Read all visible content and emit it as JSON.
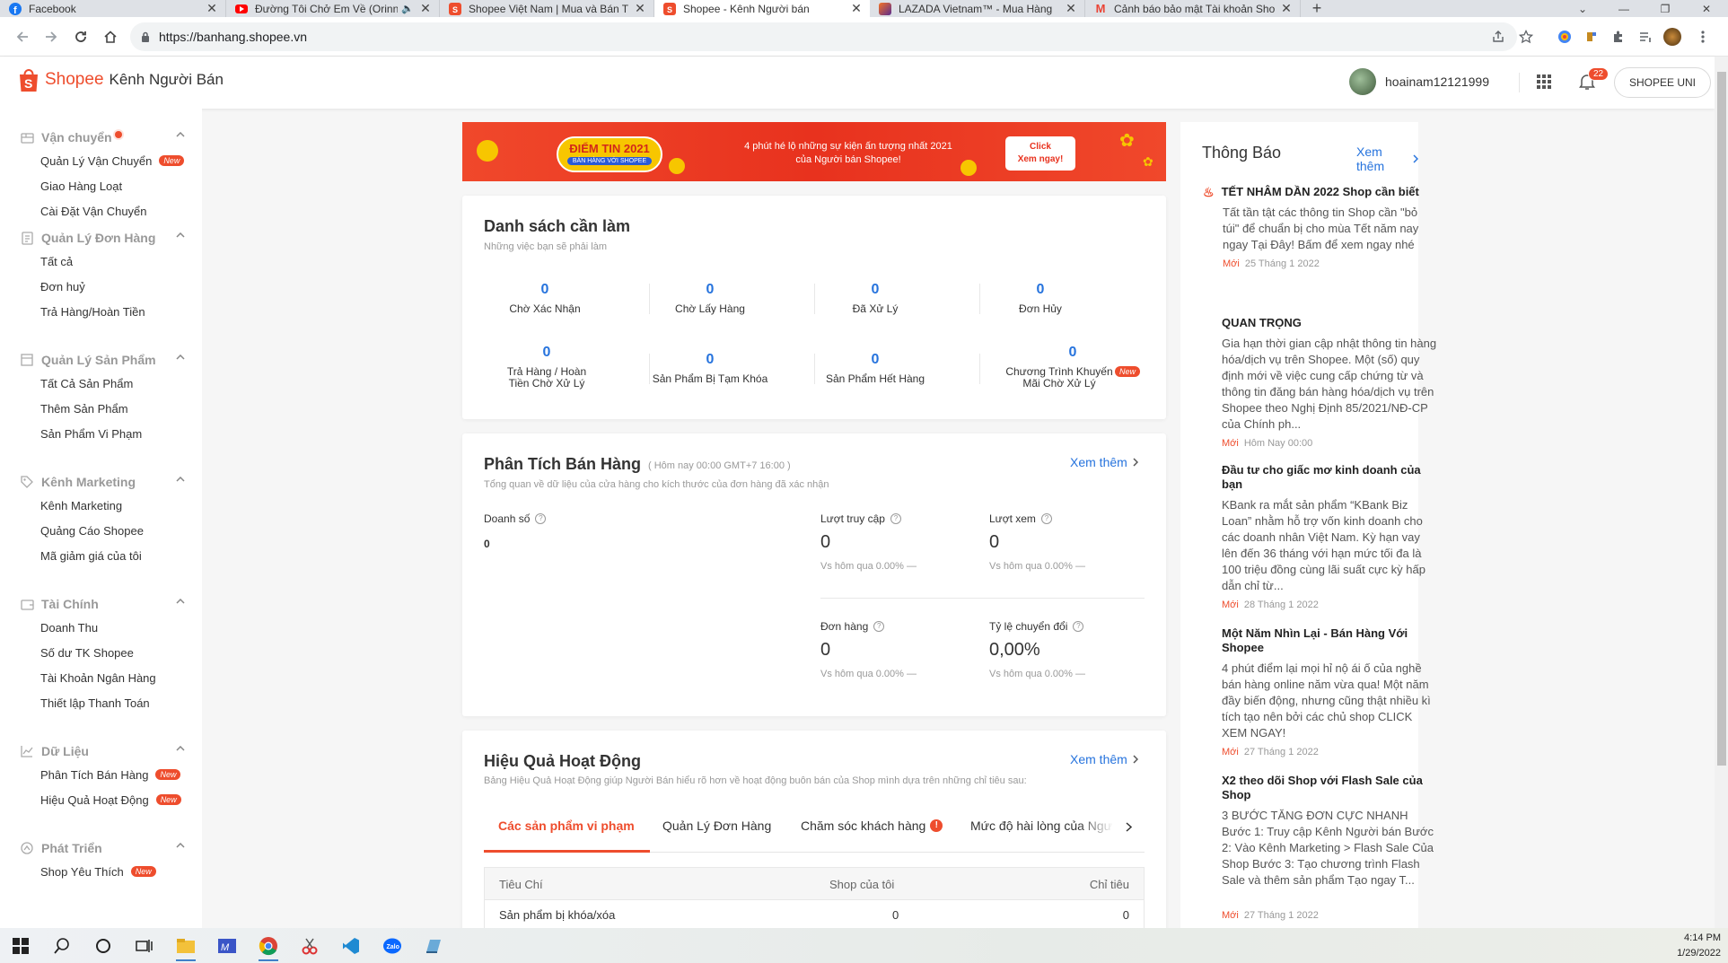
{
  "browser": {
    "tabs": [
      {
        "title": "Facebook",
        "icon": "facebook-icon",
        "color": "#1877f2"
      },
      {
        "title": "Đường Tôi Chở Em Về (Orinn",
        "icon": "youtube-icon",
        "color": "#ff0000"
      },
      {
        "title": "Shopee Việt Nam | Mua và Bán T",
        "icon": "shopee-icon",
        "color": "#ee4d2d"
      },
      {
        "title": "Shopee - Kênh Người bán",
        "icon": "shopee-icon",
        "color": "#ee4d2d",
        "active": true
      },
      {
        "title": "LAZADA Vietnam™ - Mua Hàng",
        "icon": "lazada-icon",
        "color": "#5b2d90"
      },
      {
        "title": "Cảnh báo bảo mật Tài khoản Sho",
        "icon": "gmail-icon",
        "color": "#ea4335"
      }
    ],
    "url": "https://banhang.shopee.vn"
  },
  "header": {
    "brand": "Shopee",
    "subtitle": "Kênh Người Bán",
    "username": "hoainam12121999",
    "notification_count": "22",
    "uni_button": "SHOPEE UNI"
  },
  "sidebar": {
    "groups": [
      {
        "title": "Vận chuyển",
        "icon": "truck-icon",
        "items": [
          {
            "label": "Quản Lý Vận Chuyển",
            "badge": "New"
          },
          {
            "label": "Giao Hàng Loạt"
          },
          {
            "label": "Cài Đặt Vận Chuyển"
          }
        ]
      },
      {
        "title": "Quản Lý Đơn Hàng",
        "icon": "order-icon",
        "items": [
          {
            "label": "Tất cả"
          },
          {
            "label": "Đơn huỷ"
          },
          {
            "label": "Trả Hàng/Hoàn Tiền"
          }
        ]
      },
      {
        "title": "Quản Lý Sản Phẩm",
        "icon": "product-icon",
        "items": [
          {
            "label": "Tất Cả Sản Phẩm"
          },
          {
            "label": "Thêm Sản Phẩm"
          },
          {
            "label": "Sản Phẩm Vi Phạm"
          }
        ]
      },
      {
        "title": "Kênh Marketing",
        "icon": "tag-icon",
        "items": [
          {
            "label": "Kênh Marketing"
          },
          {
            "label": "Quảng Cáo Shopee"
          },
          {
            "label": "Mã giảm giá của tôi"
          }
        ]
      },
      {
        "title": "Tài Chính",
        "icon": "wallet-icon",
        "items": [
          {
            "label": "Doanh Thu"
          },
          {
            "label": "Số dư TK Shopee"
          },
          {
            "label": "Tài Khoản Ngân Hàng"
          },
          {
            "label": "Thiết lập Thanh Toán"
          }
        ]
      },
      {
        "title": "Dữ Liệu",
        "icon": "chart-icon",
        "items": [
          {
            "label": "Phân Tích Bán Hàng",
            "badge": "New"
          },
          {
            "label": "Hiệu Quả Hoạt Động",
            "badge": "New"
          }
        ]
      },
      {
        "title": "Phát Triển",
        "icon": "growth-icon",
        "items": [
          {
            "label": "Shop Yêu Thích",
            "badge": "New"
          }
        ]
      }
    ]
  },
  "banner": {
    "badge_title": "ĐIỂM TIN 2021",
    "badge_sub": "BÁN HÀNG VỚI SHOPEE",
    "text_line1": "4 phút hé lộ những sự kiện ấn tượng nhất 2021",
    "text_line2": "của Người bán Shopee!",
    "cta_line1": "Click",
    "cta_line2": "Xem ngay!"
  },
  "todo": {
    "title": "Danh sách cần làm",
    "subtitle": "Những việc bạn sẽ phải làm",
    "items": [
      {
        "value": "0",
        "label": "Chờ Xác Nhận"
      },
      {
        "value": "0",
        "label": "Chờ Lấy Hàng"
      },
      {
        "value": "0",
        "label": "Đã Xử Lý"
      },
      {
        "value": "0",
        "label": "Đơn Hủy"
      },
      {
        "value": "0",
        "label": "Trả Hàng / Hoàn Tiền Chờ Xử Lý"
      },
      {
        "value": "0",
        "label": "Sản Phẩm Bị Tạm Khóa"
      },
      {
        "value": "0",
        "label": "Sản Phẩm Hết Hàng"
      },
      {
        "value": "0",
        "label": "Chương Trình Khuyến Mãi Chờ Xử Lý",
        "badge": "New"
      }
    ]
  },
  "sales": {
    "title": "Phân Tích Bán Hàng",
    "time": "( Hôm nay 00:00 GMT+7 16:00 )",
    "subtitle": "Tổng quan về dữ liệu của cửa hàng cho kích thước của đơn hàng đã xác nhận",
    "see_more": "Xem thêm",
    "revenue_label": "Doanh số",
    "revenue_value": "0",
    "metrics": [
      {
        "label": "Lượt truy cập",
        "value": "0",
        "compare": "Vs hôm qua 0.00% —"
      },
      {
        "label": "Lượt xem",
        "value": "0",
        "compare": "Vs hôm qua 0.00% —"
      },
      {
        "label": "Đơn hàng",
        "value": "0",
        "compare": "Vs hôm qua 0.00% —"
      },
      {
        "label": "Tỷ lệ chuyển đổi",
        "value": "0,00%",
        "compare": "Vs hôm qua 0.00% —"
      }
    ]
  },
  "performance": {
    "title": "Hiệu Quả Hoạt Động",
    "subtitle": "Bảng Hiệu Quả Hoạt Động giúp Người Bán hiểu rõ hơn về hoạt động buôn bán của Shop mình dựa trên những chỉ tiêu sau:",
    "see_more": "Xem thêm",
    "tabs": [
      "Các sản phẩm vi phạm",
      "Quản Lý Đơn Hàng",
      "Chăm sóc khách hàng",
      "Mức độ hài lòng của Ngư"
    ],
    "columns": [
      "Tiêu Chí",
      "Shop của tôi",
      "Chỉ tiêu"
    ],
    "rows": [
      [
        "Sản phẩm bị khóa/xóa",
        "0",
        "0"
      ]
    ]
  },
  "notifications": {
    "title": "Thông Báo",
    "see_more": "Xem thêm",
    "items": [
      {
        "title": "TẾT NHÂM DẦN 2022 Shop cần biết",
        "body": "Tất tần tật các thông tin Shop cần \"bỏ túi\" để chuẩn bị cho mùa Tết năm nay ngay Tại Đây! Bấm để xem ngay nhé",
        "new": "Mới",
        "date": "25 Tháng 1 2022"
      },
      {
        "title": "QUAN TRỌNG",
        "body": "Gia hạn thời gian cập nhật thông tin hàng hóa/dịch vụ trên Shopee. Một (số) quy định mới về việc cung cấp chứng từ và thông tin đăng bán hàng hóa/dịch vụ trên Shopee theo Nghị Định 85/2021/NĐ-CP của Chính ph...",
        "new": "Mới",
        "date": "Hôm Nay 00:00"
      },
      {
        "title": "Đầu tư cho giấc mơ kinh doanh của bạn",
        "body": "KBank ra mắt sản phẩm “KBank Biz Loan” nhằm hỗ trợ vốn kinh doanh cho các doanh nhân Việt Nam. Kỳ hạn vay lên đến 36 tháng với hạn mức tối đa là 100 triệu đồng cùng lãi suất cực kỳ hấp dẫn chỉ từ...",
        "new": "Mới",
        "date": "28 Tháng 1 2022"
      },
      {
        "title": "Một Năm Nhìn Lại - Bán Hàng Với Shopee",
        "body": "4 phút điểm lại mọi hỉ nộ ái ố của nghề bán hàng online năm vừa qua! Một năm đầy biến động, nhưng cũng thật nhiều kì tích tạo nên bởi các chủ shop CLICK XEM NGAY!",
        "new": "Mới",
        "date": "27 Tháng 1 2022"
      },
      {
        "title": "X2 theo dõi Shop với Flash Sale của Shop",
        "body": "3 BƯỚC TĂNG ĐƠN CỰC NHANH Bước 1: Truy cập Kênh Người bán Bước 2: Vào Kênh Marketing > Flash Sale Của Shop Bước 3: Tạo chương trình Flash Sale và thêm sản phẩm Tạo ngay T...",
        "new": "Mới",
        "date": "27 Tháng 1 2022"
      }
    ]
  },
  "taskbar": {
    "time": "4:14 PM",
    "date": "1/29/2022"
  },
  "colors": {
    "brand": "#ee4d2d",
    "link": "#2673dd"
  }
}
